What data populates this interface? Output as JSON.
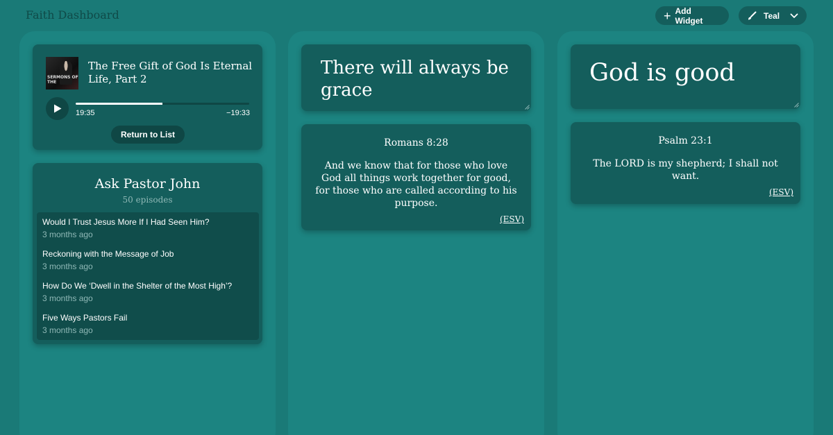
{
  "header": {
    "title": "Faith Dashboard",
    "add_widget_label": "Add Widget",
    "theme_label": "Teal"
  },
  "player": {
    "episode_title": "The Free Gift of God Is Eternal Life, Part 2",
    "art_text": "SERMONS OF THE",
    "elapsed": "19:35",
    "remaining": "−19:33",
    "progress": 0.5,
    "return_label": "Return to List"
  },
  "podcast": {
    "title": "Ask Pastor John",
    "count": "50 episodes",
    "episodes": [
      {
        "title": "Would I Trust Jesus More If I Had Seen Him?",
        "age": "3 months ago"
      },
      {
        "title": "Reckoning with the Message of Job",
        "age": "3 months ago"
      },
      {
        "title": "How Do We ‘Dwell in the Shelter of the Most High’?",
        "age": "3 months ago"
      },
      {
        "title": "Five Ways Pastors Fail",
        "age": "3 months ago"
      }
    ]
  },
  "notes": [
    {
      "text": "There will always be grace"
    },
    {
      "text": "God is good"
    }
  ],
  "verses": [
    {
      "reference": "Romans 8:28",
      "text": "And we know that for those who love God all things work together for good, for those who are called according to his purpose.",
      "version": "(ESV)"
    },
    {
      "reference": "Psalm 23:1",
      "text": "The LORD is my shepherd; I shall not want.",
      "version": "(ESV)"
    }
  ],
  "colors": {
    "background": "#1a7a77",
    "column": "#1c8481",
    "card": "#145e5c",
    "button": "#0f4745",
    "muted_text": "#8fb8b6"
  },
  "icons": [
    "plus-icon",
    "brush-icon",
    "chevron-down-icon",
    "play-icon",
    "resize-grip-icon"
  ]
}
